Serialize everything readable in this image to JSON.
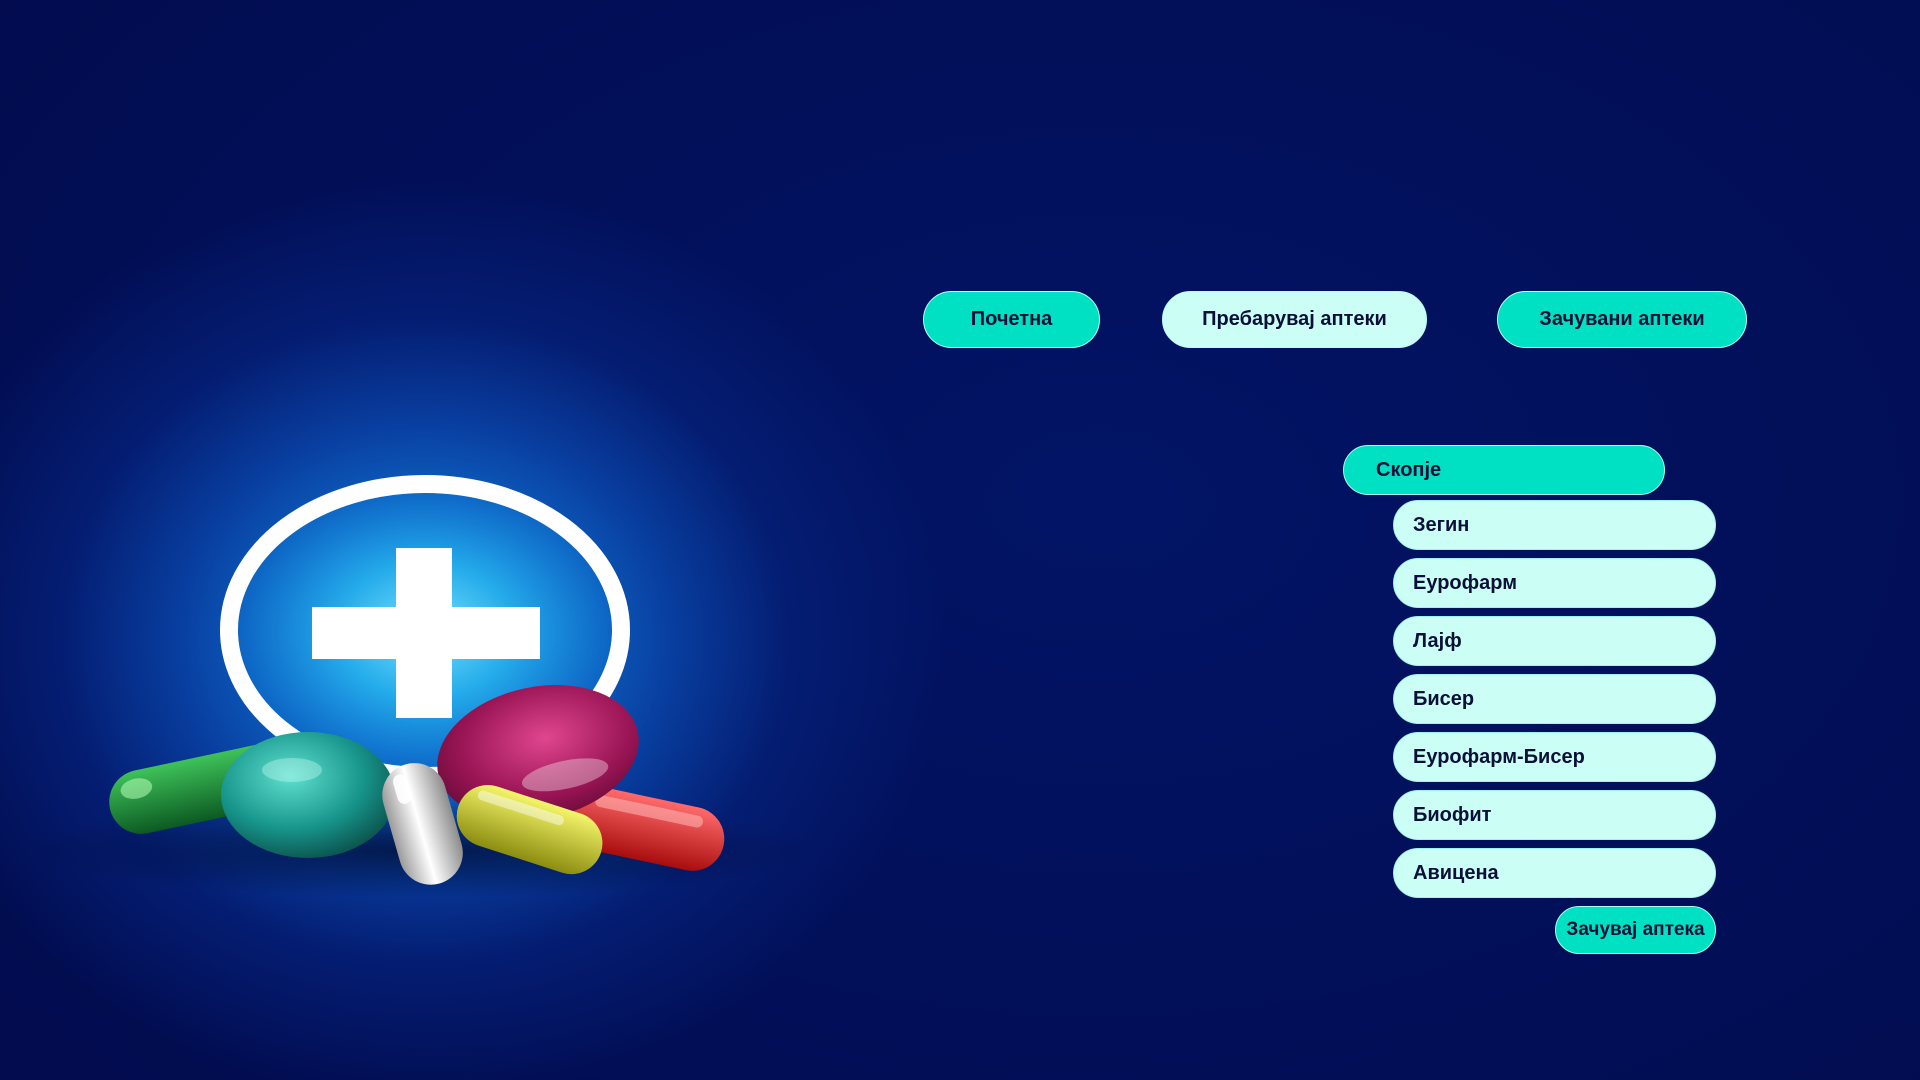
{
  "nav": {
    "home_label": "Почетна",
    "search_label": "Пребарувај аптеки",
    "saved_label": "Зачувани аптеки"
  },
  "city_select": {
    "selected": "Скопје"
  },
  "pharmacies": [
    "Зегин",
    "Еурофарм",
    "Лајф",
    "Бисер",
    "Еурофарм-Бисер",
    "Биофит",
    "Авицена"
  ],
  "save_button": {
    "label": "Зачувај аптека"
  },
  "colors": {
    "accent": "#00e0c2",
    "light_accent": "#cbfff6",
    "background": "#020f58"
  },
  "illustration": {
    "icon": "medical-cross-pills-icon"
  }
}
